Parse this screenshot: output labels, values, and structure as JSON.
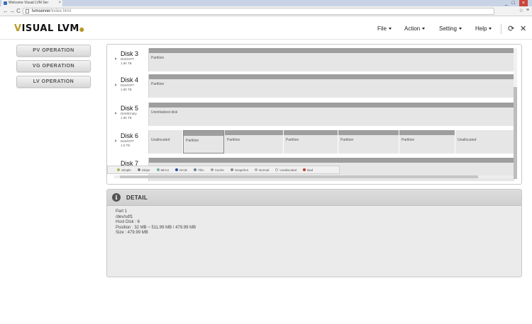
{
  "browser": {
    "tab_title": "Welcome Visual LVM Ser",
    "tab_close": "×",
    "window_controls": [
      "_",
      "□",
      "×"
    ],
    "url_host": "lvmserver",
    "url_path": "/index.html",
    "nav_back": "←",
    "nav_forward": "→",
    "nav_reload": "C"
  },
  "app": {
    "logo_v": "V",
    "logo_rest": "ISUAL LVM",
    "logo_dot": "●",
    "menus": [
      {
        "label": "File"
      },
      {
        "label": "Action"
      },
      {
        "label": "Setting"
      },
      {
        "label": "Help"
      }
    ],
    "refresh_glyph": "⟳",
    "close_glyph": "✕"
  },
  "sidebar": {
    "buttons": [
      "PV OPERATION",
      "VG OPERATION",
      "LV OPERATION"
    ]
  },
  "disks": [
    {
      "name": "Disk 3",
      "type": "Disk/GPT",
      "size": "1.86 TB",
      "segments": [
        {
          "label": "Partition",
          "bar": true
        }
      ]
    },
    {
      "name": "Disk 4",
      "type": "Disk/GPT",
      "size": "1.86 TB",
      "segments": [
        {
          "label": "Partition",
          "bar": true
        }
      ]
    },
    {
      "name": "Disk 5",
      "type": "Disk/Empty",
      "size": "1.86 TB",
      "segments": [
        {
          "label": "Uninitialized disk",
          "bar": true
        }
      ]
    },
    {
      "name": "Disk 6",
      "type": "Disk/GPT",
      "size": "1.5 TB",
      "segments": [
        {
          "label": "Unallocated",
          "bar": false
        },
        {
          "label": "Partition",
          "bar": true,
          "selected": true
        },
        {
          "label": "Partition",
          "bar": true
        },
        {
          "label": "Partition",
          "bar": true
        },
        {
          "label": "Partition",
          "bar": true
        },
        {
          "label": "Partition",
          "bar": true
        },
        {
          "label": "Unallocated",
          "bar": false
        }
      ]
    },
    {
      "name": "Disk 7",
      "type": "Disk/Empty",
      "size": "",
      "segments": [
        {
          "label": "",
          "bar": true
        }
      ]
    }
  ],
  "legend": [
    {
      "label": "Simple",
      "color": "#9bbb59"
    },
    {
      "label": "Stripe",
      "color": "#7f7f7f"
    },
    {
      "label": "Mirror",
      "color": "#76b39d"
    },
    {
      "label": "RAID",
      "color": "#1f4e9a"
    },
    {
      "label": "Thin",
      "color": "#6d7f94"
    },
    {
      "label": "Cache",
      "color": "#a0a0a0"
    },
    {
      "label": "Snapshot",
      "color": "#8a8a8a"
    },
    {
      "label": "Normal",
      "color": "#b0b0b0"
    },
    {
      "label": "Unallocated",
      "color": "#ffffff"
    },
    {
      "label": "Bad",
      "color": "#c0392b"
    }
  ],
  "detail": {
    "title": "DETAIL",
    "info_glyph": "i",
    "lines": [
      "Part 1",
      "/dev/sdf1",
      "Host Disk : 6",
      "Position : 32 MB ~ 511.99 MB / 479.99 MB",
      "Size : 479.99 MB"
    ]
  }
}
